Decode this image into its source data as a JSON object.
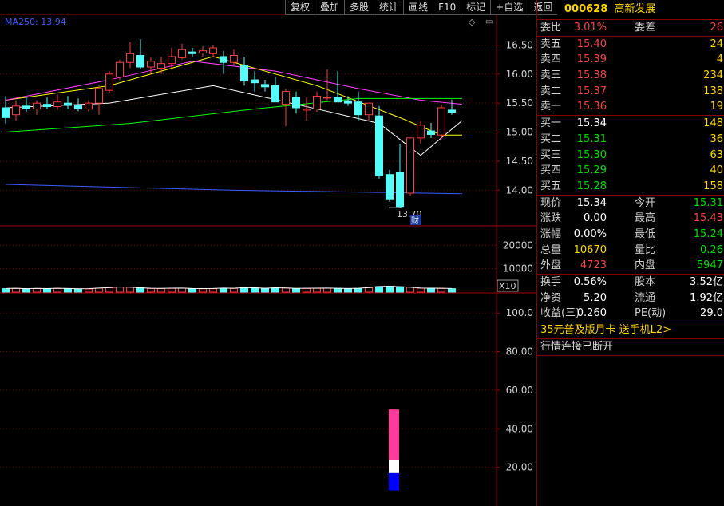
{
  "toolbar": [
    "复权",
    "叠加",
    "多股",
    "统计",
    "画线",
    "F10",
    "标记",
    "+自选",
    "返回"
  ],
  "ma_label": "MA250: 13.94",
  "icons": {
    "diamond": "◇",
    "small": "▭"
  },
  "colors": {
    "up": "#ff3c3c",
    "down": "#54fcfc",
    "ma5": "#ffffff",
    "ma10": "#ffff00",
    "ma20": "#ff40ff",
    "ma60": "#00ff00",
    "ma250": "#3b5cff",
    "axis": "#a00000"
  },
  "price_axis": [
    "16.50",
    "16.00",
    "15.50",
    "15.00",
    "14.50",
    "14.00"
  ],
  "price_low_label": "13.70",
  "cai_label": "财",
  "volume_axis": [
    "20000",
    "10000"
  ],
  "volume_unit": "X10",
  "indicator_axis": [
    "100.0",
    "80.00",
    "60.00",
    "40.00",
    "20.00"
  ],
  "chart_data": {
    "type": "candlestick",
    "ylim": [
      13.4,
      17.0
    ],
    "candles": [
      {
        "o": 15.42,
        "h": 15.62,
        "l": 15.15,
        "c": 15.25
      },
      {
        "o": 15.3,
        "h": 15.55,
        "l": 15.2,
        "c": 15.45
      },
      {
        "o": 15.45,
        "h": 15.6,
        "l": 15.35,
        "c": 15.4
      },
      {
        "o": 15.4,
        "h": 15.55,
        "l": 15.3,
        "c": 15.5
      },
      {
        "o": 15.48,
        "h": 15.6,
        "l": 15.4,
        "c": 15.44
      },
      {
        "o": 15.44,
        "h": 15.65,
        "l": 15.38,
        "c": 15.52
      },
      {
        "o": 15.5,
        "h": 15.62,
        "l": 15.4,
        "c": 15.46
      },
      {
        "o": 15.46,
        "h": 15.58,
        "l": 15.36,
        "c": 15.4
      },
      {
        "o": 15.4,
        "h": 15.55,
        "l": 15.36,
        "c": 15.5
      },
      {
        "o": 15.5,
        "h": 15.8,
        "l": 15.3,
        "c": 15.75
      },
      {
        "o": 15.72,
        "h": 16.05,
        "l": 15.68,
        "c": 16.0
      },
      {
        "o": 15.95,
        "h": 16.25,
        "l": 15.9,
        "c": 16.2
      },
      {
        "o": 16.2,
        "h": 16.55,
        "l": 16.1,
        "c": 16.35
      },
      {
        "o": 16.32,
        "h": 16.6,
        "l": 16.08,
        "c": 16.12
      },
      {
        "o": 16.12,
        "h": 16.28,
        "l": 16.0,
        "c": 16.22
      },
      {
        "o": 16.1,
        "h": 16.3,
        "l": 16.0,
        "c": 16.18
      },
      {
        "o": 16.18,
        "h": 16.45,
        "l": 16.1,
        "c": 16.3
      },
      {
        "o": 16.28,
        "h": 16.52,
        "l": 16.25,
        "c": 16.42
      },
      {
        "o": 16.38,
        "h": 16.45,
        "l": 16.3,
        "c": 16.35
      },
      {
        "o": 16.36,
        "h": 16.48,
        "l": 16.3,
        "c": 16.4
      },
      {
        "o": 16.35,
        "h": 16.5,
        "l": 16.3,
        "c": 16.45
      },
      {
        "o": 16.3,
        "h": 16.4,
        "l": 16.0,
        "c": 16.2
      },
      {
        "o": 16.2,
        "h": 16.42,
        "l": 16.15,
        "c": 16.32
      },
      {
        "o": 16.15,
        "h": 16.3,
        "l": 15.8,
        "c": 15.88
      },
      {
        "o": 15.9,
        "h": 16.05,
        "l": 15.7,
        "c": 15.85
      },
      {
        "o": 15.82,
        "h": 15.9,
        "l": 15.7,
        "c": 15.78
      },
      {
        "o": 15.8,
        "h": 15.95,
        "l": 15.55,
        "c": 15.52
      },
      {
        "o": 15.48,
        "h": 15.75,
        "l": 15.1,
        "c": 15.7
      },
      {
        "o": 15.6,
        "h": 15.7,
        "l": 15.32,
        "c": 15.42
      },
      {
        "o": 15.38,
        "h": 15.6,
        "l": 15.2,
        "c": 15.4
      },
      {
        "o": 15.4,
        "h": 15.7,
        "l": 15.35,
        "c": 15.62
      },
      {
        "o": 15.6,
        "h": 16.08,
        "l": 15.55,
        "c": 15.6
      },
      {
        "o": 15.6,
        "h": 16.05,
        "l": 15.55,
        "c": 15.52
      },
      {
        "o": 15.54,
        "h": 15.62,
        "l": 15.45,
        "c": 15.5
      },
      {
        "o": 15.52,
        "h": 15.7,
        "l": 15.2,
        "c": 15.3
      },
      {
        "o": 15.3,
        "h": 15.5,
        "l": 15.2,
        "c": 15.5
      },
      {
        "o": 15.28,
        "h": 15.45,
        "l": 14.2,
        "c": 14.25
      },
      {
        "o": 14.27,
        "h": 14.35,
        "l": 13.8,
        "c": 13.85
      },
      {
        "o": 14.3,
        "h": 14.8,
        "l": 13.7,
        "c": 13.72
      },
      {
        "o": 13.95,
        "h": 14.75,
        "l": 13.9,
        "c": 14.9
      },
      {
        "o": 14.9,
        "h": 15.2,
        "l": 14.8,
        "c": 15.12
      },
      {
        "o": 15.02,
        "h": 15.16,
        "l": 14.9,
        "c": 14.96
      },
      {
        "o": 14.95,
        "h": 15.48,
        "l": 14.88,
        "c": 15.42
      },
      {
        "o": 15.38,
        "h": 15.56,
        "l": 15.3,
        "c": 15.34
      }
    ],
    "ma": {
      "ma5": [
        [
          0,
          15.42
        ],
        [
          10,
          15.5
        ],
        [
          20,
          15.8
        ],
        [
          30,
          15.4
        ],
        [
          36,
          15.15
        ],
        [
          40,
          14.6
        ],
        [
          44,
          15.2
        ]
      ],
      "ma10": [
        [
          0,
          15.55
        ],
        [
          10,
          15.8
        ],
        [
          20,
          16.3
        ],
        [
          30,
          15.8
        ],
        [
          38,
          15.25
        ],
        [
          42,
          14.95
        ],
        [
          44,
          14.95
        ]
      ],
      "ma20": [
        [
          0,
          15.55
        ],
        [
          10,
          15.9
        ],
        [
          18,
          16.22
        ],
        [
          26,
          16.05
        ],
        [
          34,
          15.75
        ],
        [
          40,
          15.55
        ],
        [
          44,
          15.48
        ]
      ],
      "ma60": [
        [
          0,
          15.0
        ],
        [
          12,
          15.15
        ],
        [
          24,
          15.4
        ],
        [
          34,
          15.58
        ],
        [
          44,
          15.58
        ]
      ],
      "ma250": [
        [
          0,
          14.1
        ],
        [
          22,
          14.0
        ],
        [
          44,
          13.94
        ]
      ]
    },
    "volume_ylim": [
      0,
      28000
    ],
    "volumes": [
      1500,
      1600,
      1400,
      1550,
      1450,
      1600,
      1500,
      1350,
      1400,
      1700,
      1900,
      2200,
      2100,
      1800,
      1600,
      1550,
      1650,
      1700,
      1500,
      1450,
      1500,
      1700,
      1600,
      1900,
      1800,
      1600,
      1800,
      1750,
      1550,
      1600,
      1650,
      1700,
      1600,
      1500,
      1600,
      1900,
      2400,
      2500,
      2300,
      2100,
      1700,
      1650,
      1600,
      1500
    ],
    "indicator_ylim": [
      0,
      110
    ],
    "indicator_bars": [
      {
        "from": 24,
        "to": 50,
        "color": "#ff3c9c"
      },
      {
        "from": 17,
        "to": 24,
        "color": "#ffffff"
      },
      {
        "from": 8,
        "to": 17,
        "color": "#0000ff"
      }
    ]
  },
  "quote": {
    "code": "000628",
    "name": "高新发展",
    "weibi_label": "委比",
    "weibi": "3.01%",
    "weicha_label": "委差",
    "weicha": "26",
    "asks": [
      {
        "label": "卖五",
        "price": "15.40",
        "vol": "24"
      },
      {
        "label": "卖四",
        "price": "15.39",
        "vol": "4"
      },
      {
        "label": "卖三",
        "price": "15.38",
        "vol": "234"
      },
      {
        "label": "卖二",
        "price": "15.37",
        "vol": "138"
      },
      {
        "label": "卖一",
        "price": "15.36",
        "vol": "19"
      }
    ],
    "bids": [
      {
        "label": "买一",
        "price": "15.34",
        "vol": "148",
        "cls": "white"
      },
      {
        "label": "买二",
        "price": "15.31",
        "vol": "36",
        "cls": "green"
      },
      {
        "label": "买三",
        "price": "15.30",
        "vol": "63",
        "cls": "green"
      },
      {
        "label": "买四",
        "price": "15.29",
        "vol": "40",
        "cls": "green"
      },
      {
        "label": "买五",
        "price": "15.28",
        "vol": "158",
        "cls": "green"
      }
    ],
    "stats1": [
      {
        "l1": "现价",
        "v1": "15.34",
        "c1": "white",
        "l2": "今开",
        "v2": "15.31",
        "c2": "green"
      },
      {
        "l1": "涨跌",
        "v1": "0.00",
        "c1": "white",
        "l2": "最高",
        "v2": "15.43",
        "c2": "red"
      },
      {
        "l1": "涨幅",
        "v1": "0.00%",
        "c1": "white",
        "l2": "最低",
        "v2": "15.24",
        "c2": "green"
      },
      {
        "l1": "总量",
        "v1": "10670",
        "c1": "yellow",
        "l2": "量比",
        "v2": "0.26",
        "c2": "green"
      },
      {
        "l1": "外盘",
        "v1": "4723",
        "c1": "red",
        "l2": "内盘",
        "v2": "5947",
        "c2": "green"
      }
    ],
    "stats2": [
      {
        "l1": "换手",
        "v1": "0.56%",
        "c1": "white",
        "l2": "股本",
        "v2": "3.52亿",
        "c2": "white"
      },
      {
        "l1": "净资",
        "v1": "5.20",
        "c1": "white",
        "l2": "流通",
        "v2": "1.92亿",
        "c2": "white"
      },
      {
        "l1": "收益(三)",
        "v1": "0.260",
        "c1": "white",
        "l2": "PE(动)",
        "v2": "29.0",
        "c2": "white"
      }
    ],
    "ad_text": "35元普及版月卡 送手机L2>",
    "status_text": "行情连接已断开"
  }
}
